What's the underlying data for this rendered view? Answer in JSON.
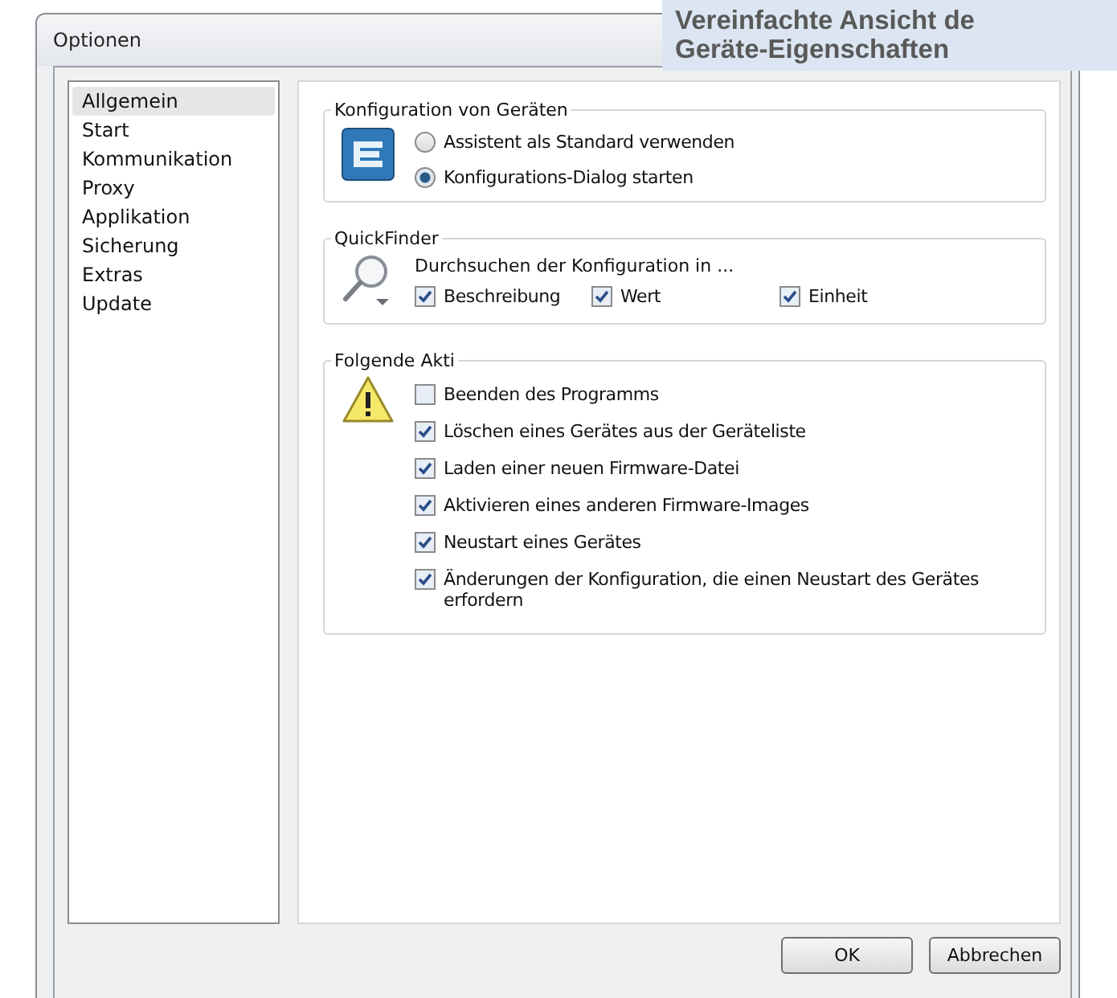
{
  "window": {
    "title": "Optionen"
  },
  "callout": {
    "lines": [
      "Vereinfachte Ansicht de",
      "Geräte-Eigenschaften"
    ]
  },
  "sidebar": {
    "items": [
      {
        "label": "Allgemein",
        "selected": true
      },
      {
        "label": "Start",
        "selected": false
      },
      {
        "label": "Kommunikation",
        "selected": false
      },
      {
        "label": "Proxy",
        "selected": false
      },
      {
        "label": "Applikation",
        "selected": false
      },
      {
        "label": "Sicherung",
        "selected": false
      },
      {
        "label": "Extras",
        "selected": false
      },
      {
        "label": "Update",
        "selected": false
      }
    ]
  },
  "config_group": {
    "title": "Konfiguration von Geräten",
    "options": [
      {
        "label": "Assistent als Standard verwenden",
        "selected": false
      },
      {
        "label": "Konfigurations-Dialog starten",
        "selected": true
      }
    ]
  },
  "quickfinder_group": {
    "title": "QuickFinder",
    "text": "Durchsuchen der Konfiguration in ...",
    "options": [
      {
        "label": "Beschreibung",
        "checked": true
      },
      {
        "label": "Wert",
        "checked": true
      },
      {
        "label": "Einheit",
        "checked": true
      }
    ]
  },
  "actions_group": {
    "title": "Folgende Akti",
    "options": [
      {
        "label": "Beenden des Programms",
        "checked": false
      },
      {
        "label": "Löschen eines Gerätes aus der Geräteliste",
        "checked": true
      },
      {
        "label": "Laden einer neuen Firmware-Datei",
        "checked": true
      },
      {
        "label": "Aktivieren eines anderen Firmware-Images",
        "checked": true
      },
      {
        "label": "Neustart eines Gerätes",
        "checked": true
      },
      {
        "label": "Änderungen der Konfiguration, die einen Neustart des Gerätes erfordern",
        "checked": true
      }
    ]
  },
  "buttons": [
    "OK",
    "Abbrechen"
  ]
}
